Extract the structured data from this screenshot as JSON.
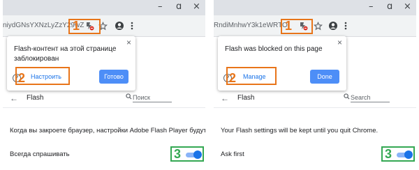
{
  "window": {
    "minimize": "–",
    "restore": "ɑ",
    "close": "×"
  },
  "panels": {
    "ru": {
      "url": "niydGNsYXNzLyZzY29wZ",
      "step1": "1",
      "step2": "2",
      "step3": "3",
      "bubble": {
        "message": "Flash-контент на этой странице заблокирован",
        "close": "×",
        "help": "?",
        "manage": "Настроить",
        "done": "Готово"
      },
      "settings": {
        "back": "←",
        "title": "Flash",
        "search_placeholder": "Поиск",
        "info": "Когда вы закроете браузер, настройки Adobe Flash Player будут сброшены.",
        "ask_first": "Всегда спрашивать"
      }
    },
    "en": {
      "url": "RndiMnhwY3k1eWRTO",
      "step1": "1",
      "step2": "2",
      "step3": "3",
      "bubble": {
        "message": "Flash was blocked on this page",
        "close": "×",
        "help": "?",
        "manage": "Manage",
        "done": "Done"
      },
      "settings": {
        "back": "←",
        "title": "Flash",
        "search_placeholder": "Search",
        "info": "Your Flash settings will be kept until you quit Chrome.",
        "ask_first": "Ask first"
      }
    }
  },
  "toggle_state": {
    "ask_first_on": true
  },
  "colors": {
    "highlight_orange": "#e8751a",
    "highlight_green": "#34a853",
    "toggle_blue": "#1a73e8",
    "done_button": "#4d8ef7"
  },
  "icons": [
    "flash-blocked-icon",
    "star-icon",
    "account-icon",
    "menu-icon",
    "help-icon",
    "close-icon",
    "back-arrow-icon",
    "search-icon"
  ]
}
